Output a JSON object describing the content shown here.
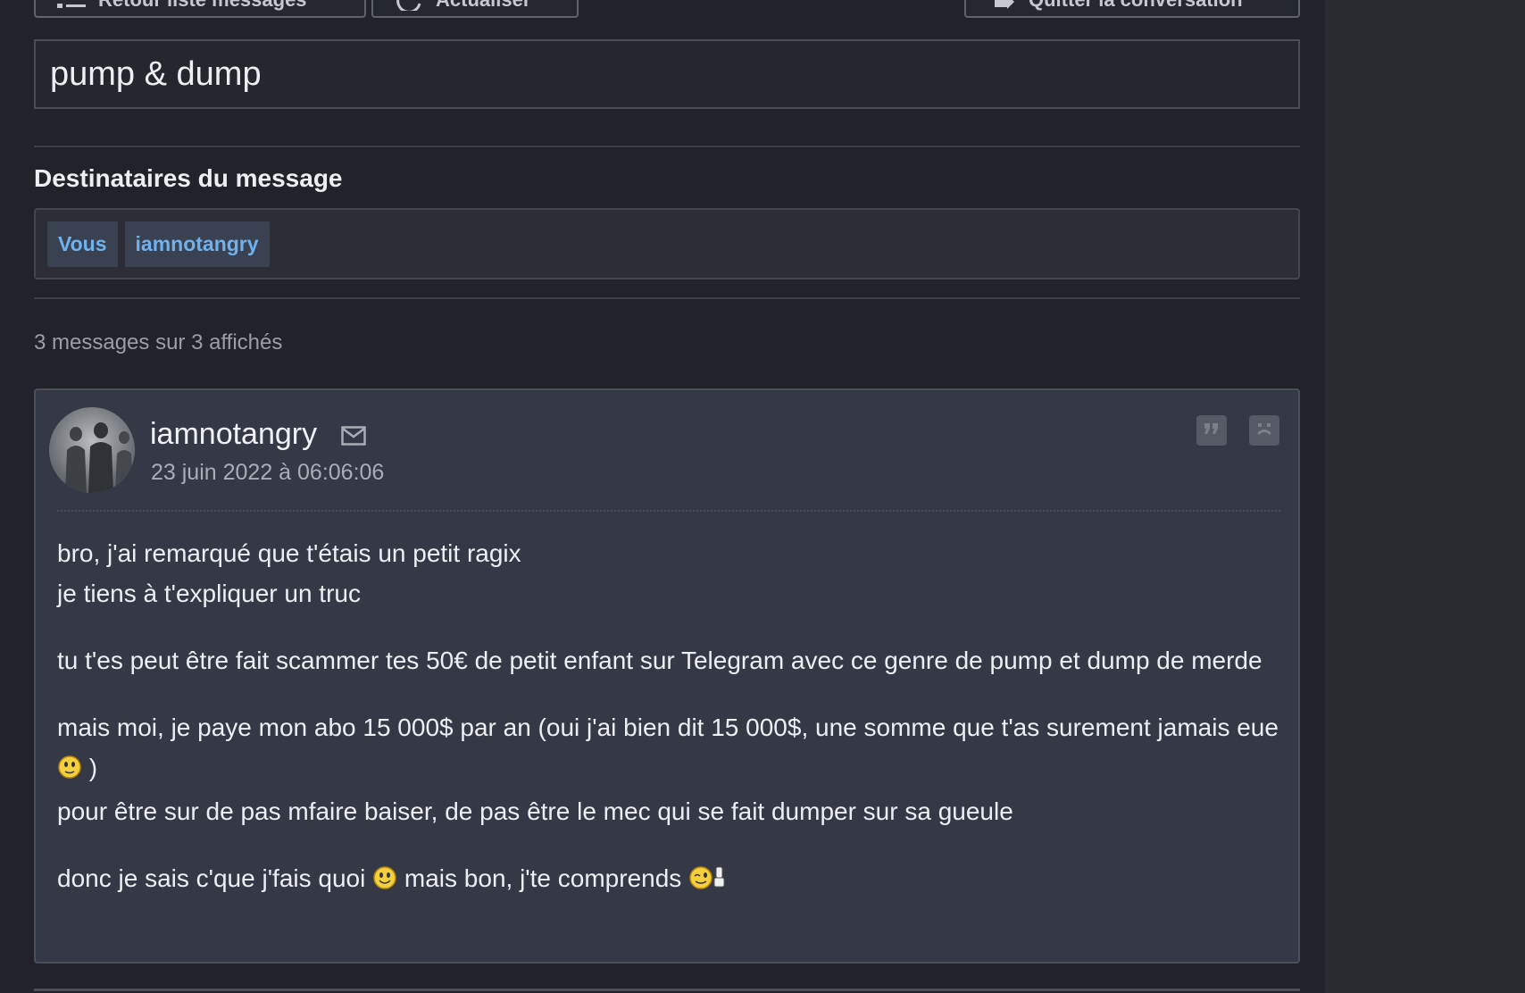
{
  "toolbar": {
    "back_label": "Retour liste messages",
    "refresh_label": "Actualiser",
    "leave_label": "Quitter la conversation"
  },
  "conversation": {
    "title": "pump & dump"
  },
  "recipients": {
    "heading": "Destinataires du message",
    "tags": [
      "Vous",
      "iamnotangry"
    ]
  },
  "messages_count": "3 messages sur 3 affichés",
  "message": {
    "author": "iamnotangry",
    "date": "23 juin 2022 à 06:06:06",
    "lines": {
      "l1": "bro, j'ai remarqué que t'étais un petit ragix",
      "l2": "je tiens à t'expliquer un truc",
      "p2": "tu t'es peut être fait scammer tes 50€ de petit enfant sur Telegram avec ce genre de pump et dump de merde",
      "p3a": "mais moi, je paye mon abo 15 000$ par an (oui j'ai bien dit 15 000$, une somme que t'as surement jamais eue ",
      "p3b": " )",
      "p3c": "pour être sur de pas mfaire baiser, de pas être le mec qui se fait dumper sur sa gueule",
      "p4a": "donc je sais c'que j'fais quoi ",
      "p4b": " mais bon, j'te comprends "
    }
  },
  "colors": {
    "background": "#22232a",
    "card": "#353945",
    "tag_text": "#6fb2f0",
    "tag_bg": "#3a4150"
  }
}
